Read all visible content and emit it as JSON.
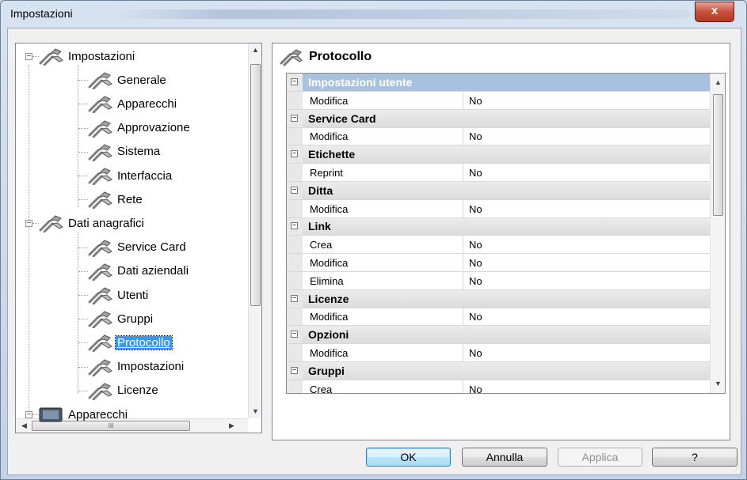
{
  "window": {
    "title": "Impostazioni",
    "close_glyph": "x"
  },
  "tree": {
    "items": [
      {
        "label": "Impostazioni",
        "icon": "tools-icon",
        "expander": "−"
      },
      {
        "label": "Generale",
        "icon": "tools-icon"
      },
      {
        "label": "Apparecchi",
        "icon": "tools-icon"
      },
      {
        "label": "Approvazione",
        "icon": "tools-icon"
      },
      {
        "label": "Sistema",
        "icon": "tools-icon"
      },
      {
        "label": "Interfaccia",
        "icon": "tools-icon"
      },
      {
        "label": "Rete",
        "icon": "tools-icon"
      },
      {
        "label": "Dati anagrafici",
        "icon": "tools-icon",
        "expander": "−"
      },
      {
        "label": "Service Card",
        "icon": "tools-icon"
      },
      {
        "label": "Dati aziendali",
        "icon": "tools-icon"
      },
      {
        "label": "Utenti",
        "icon": "tools-icon"
      },
      {
        "label": "Gruppi",
        "icon": "tools-icon"
      },
      {
        "label": "Protocollo",
        "icon": "tools-icon",
        "selected": true
      },
      {
        "label": "Impostazioni",
        "icon": "tools-icon"
      },
      {
        "label": "Licenze",
        "icon": "tools-icon"
      },
      {
        "label": "Apparecchi",
        "icon": "device-icon",
        "expander": "−"
      }
    ],
    "hscroll_grip": "III"
  },
  "panel": {
    "title": "Protocollo"
  },
  "properties": [
    {
      "type": "category",
      "name": "Impostazioni utente",
      "selected": true
    },
    {
      "type": "prop",
      "name": "Modifica",
      "value": "No"
    },
    {
      "type": "category",
      "name": "Service Card"
    },
    {
      "type": "prop",
      "name": "Modifica",
      "value": "No"
    },
    {
      "type": "category",
      "name": "Etichette"
    },
    {
      "type": "prop",
      "name": "Reprint",
      "value": "No"
    },
    {
      "type": "category",
      "name": "Ditta"
    },
    {
      "type": "prop",
      "name": "Modifica",
      "value": "No"
    },
    {
      "type": "category",
      "name": "Link"
    },
    {
      "type": "prop",
      "name": "Crea",
      "value": "No"
    },
    {
      "type": "prop",
      "name": "Modifica",
      "value": "No"
    },
    {
      "type": "prop",
      "name": "Elimina",
      "value": "No"
    },
    {
      "type": "category",
      "name": "Licenze"
    },
    {
      "type": "prop",
      "name": "Modifica",
      "value": "No"
    },
    {
      "type": "category",
      "name": "Opzioni"
    },
    {
      "type": "prop",
      "name": "Modifica",
      "value": "No"
    },
    {
      "type": "category",
      "name": "Gruppi"
    },
    {
      "type": "prop",
      "name": "Crea",
      "value": "No"
    }
  ],
  "buttons": {
    "ok": "OK",
    "cancel": "Annulla",
    "apply": "Applica",
    "help": "?"
  },
  "colors": {
    "selection": "#3399ff",
    "window_chrome": "#c9d7e6"
  }
}
